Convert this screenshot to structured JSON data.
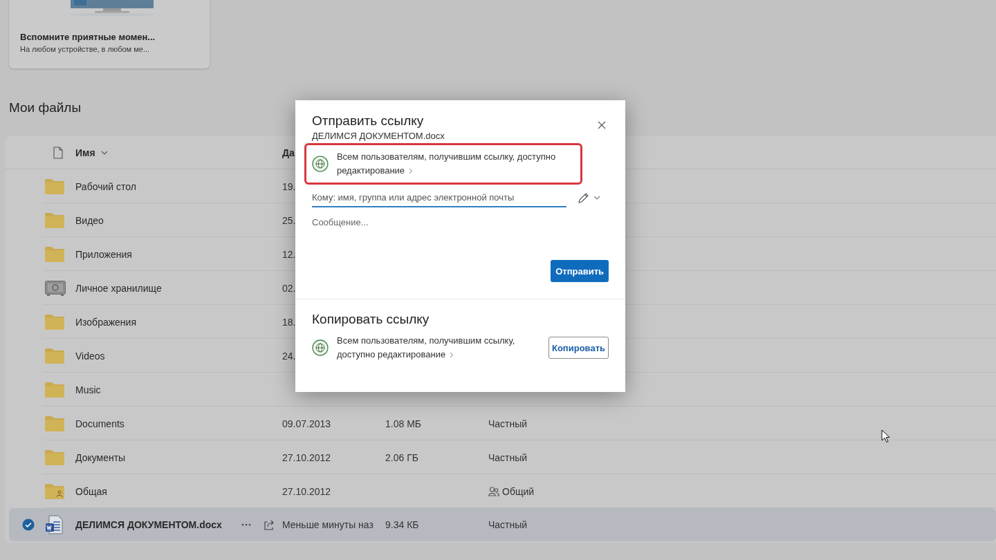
{
  "promo_card": {
    "title": "Вспомните приятные момен...",
    "subtitle": "На любом устройстве, в любом ме..."
  },
  "section_title": "Мои файлы",
  "table": {
    "columns": [
      {
        "label": "Имя",
        "sorted": true
      },
      {
        "label": "Да",
        "sorted": false
      }
    ],
    "rows": [
      {
        "kind": "folder",
        "name": "Рабочий стол",
        "date": "19.",
        "selected": false
      },
      {
        "kind": "folder",
        "name": "Видео",
        "date": "25.",
        "selected": false
      },
      {
        "kind": "folder",
        "name": "Приложения",
        "date": "12.",
        "selected": false
      },
      {
        "kind": "vault",
        "name": "Личное хранилище",
        "date": "02.",
        "selected": false
      },
      {
        "kind": "folder",
        "name": "Изображения",
        "date": "18.",
        "selected": false
      },
      {
        "kind": "folder",
        "name": "Videos",
        "date": "24.",
        "selected": false
      },
      {
        "kind": "folder",
        "name": "Music",
        "selected": false
      },
      {
        "kind": "folder",
        "name": "Documents",
        "date": "09.07.2013",
        "size": "1.08 МБ",
        "access": "Частный",
        "shared": false,
        "selected": false
      },
      {
        "kind": "folder",
        "name": "Документы",
        "date": "27.10.2012",
        "size": "2.06 ГБ",
        "access": "Частный",
        "shared": false,
        "selected": false
      },
      {
        "kind": "shared-folder",
        "name": "Общая",
        "date": "27.10.2012",
        "access": "Общий",
        "shared": true,
        "selected": false
      },
      {
        "kind": "word",
        "name": "ДЕЛИМСЯ ДОКУМЕНТОМ.docx",
        "date": "Меньше минуты наз",
        "size": "9.34 КБ",
        "access": "Частный",
        "shared": false,
        "selected": true
      }
    ]
  },
  "dialog": {
    "title": "Отправить ссылку",
    "file_name": "ДЕЛИМСЯ ДОКУМЕНТОМ.docx",
    "permission": {
      "text": "Всем пользователям, получившим ссылку, доступно редактирование",
      "highlighted": true
    },
    "to_field": {
      "placeholder": "Кому: имя, группа или адрес электронной почты"
    },
    "message_field": {
      "placeholder": "Сообщение..."
    },
    "send_button": "Отправить",
    "copy_section": {
      "title": "Копировать ссылку",
      "permission": {
        "text": "Всем пользователям, получившим ссылку, доступно редактирование",
        "highlighted": false
      },
      "copy_button": "Копировать"
    }
  }
}
